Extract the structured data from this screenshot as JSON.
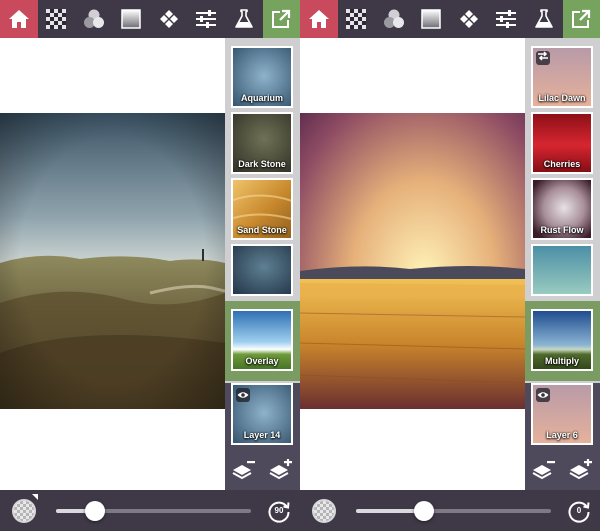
{
  "colors": {
    "toolbar_bg": "#3f3947",
    "home_accent": "#c84a5c",
    "share_accent": "#76a45e",
    "blend_highlight": "#7a9b62",
    "layer_panel_bg": "#4f4a5b",
    "side_panel_bg": "#cfcfd2"
  },
  "toolbar": {
    "tools": [
      {
        "icon": "home-icon"
      },
      {
        "icon": "checkerboard-icon"
      },
      {
        "icon": "color-circles-icon"
      },
      {
        "icon": "gradient-square-icon"
      },
      {
        "icon": "diamond-grid-icon"
      },
      {
        "icon": "adjust-sliders-icon"
      },
      {
        "icon": "flask-icon"
      },
      {
        "icon": "export-icon"
      }
    ]
  },
  "screens": [
    {
      "textures": [
        {
          "label": "Aquarium"
        },
        {
          "label": "Dark Stone"
        },
        {
          "label": "Sand Stone"
        },
        {
          "label": ""
        }
      ],
      "blend_mode": {
        "label": "Overlay"
      },
      "layer": {
        "label": "Layer 14",
        "visible": true
      },
      "opacity_value": 0.2,
      "rotation_label": "90"
    },
    {
      "textures": [
        {
          "label": "Lilac Dawn"
        },
        {
          "label": "Cherries"
        },
        {
          "label": "Rust Flow"
        },
        {
          "label": ""
        }
      ],
      "blend_mode": {
        "label": "Multiply"
      },
      "layer": {
        "label": "Layer 6",
        "visible": true
      },
      "opacity_value": 0.35,
      "rotation_label": "0"
    }
  ]
}
